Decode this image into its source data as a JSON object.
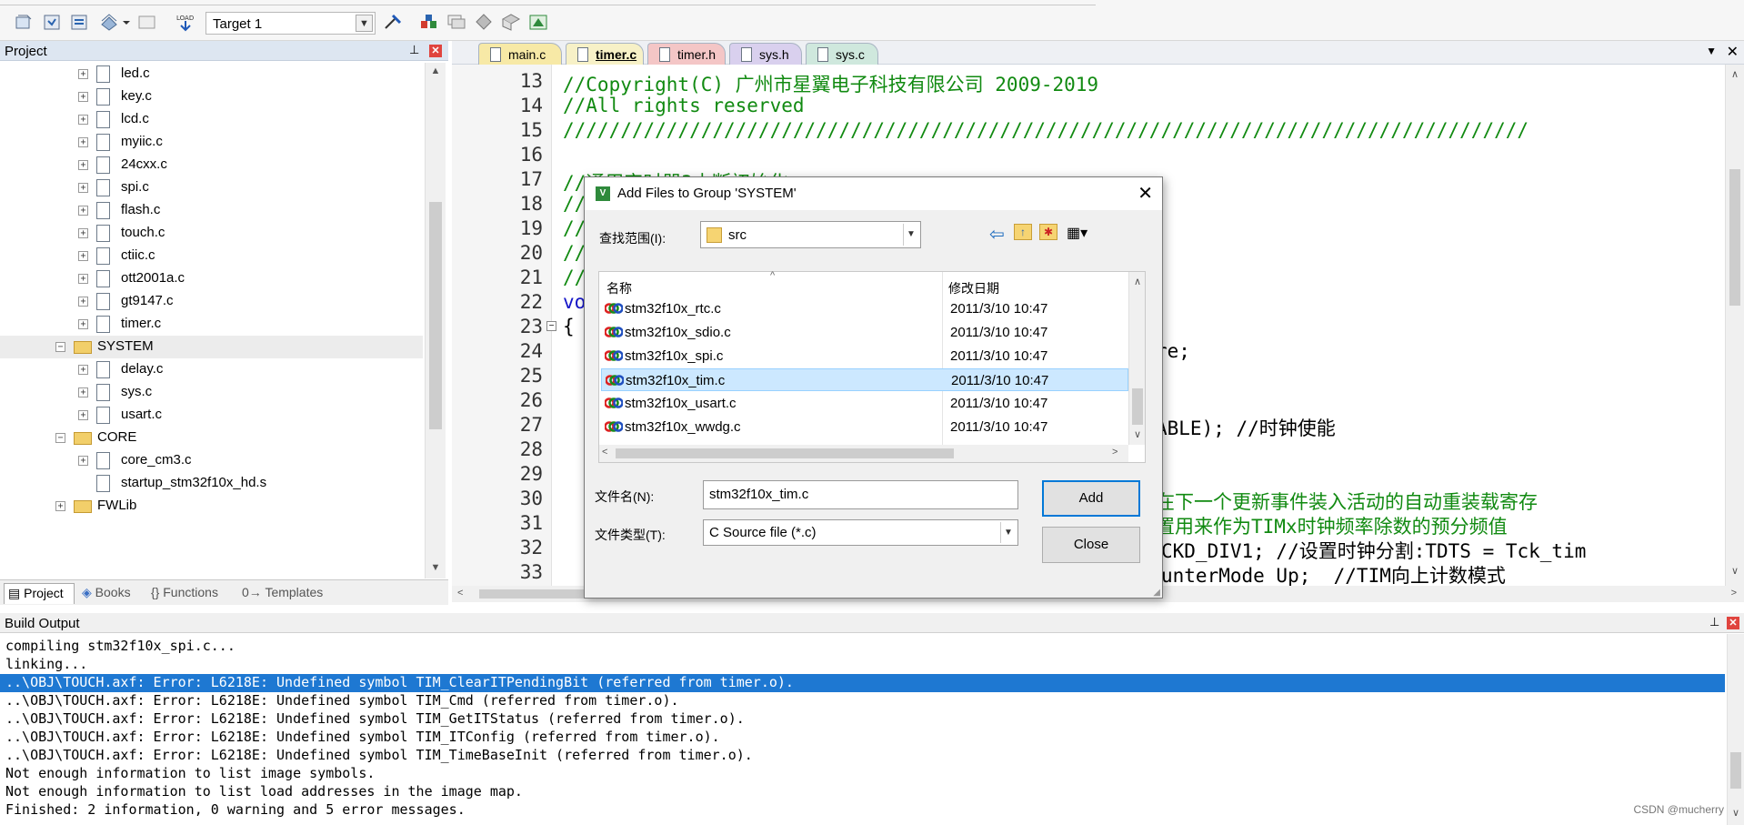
{
  "toolbar": {
    "target_value": "Target 1"
  },
  "project_panel": {
    "title": "Project",
    "tree": [
      {
        "label": "led.c",
        "kind": "file"
      },
      {
        "label": "key.c",
        "kind": "file"
      },
      {
        "label": "lcd.c",
        "kind": "file"
      },
      {
        "label": "myiic.c",
        "kind": "file"
      },
      {
        "label": "24cxx.c",
        "kind": "file"
      },
      {
        "label": "spi.c",
        "kind": "file"
      },
      {
        "label": "flash.c",
        "kind": "file"
      },
      {
        "label": "touch.c",
        "kind": "file"
      },
      {
        "label": "ctiic.c",
        "kind": "file"
      },
      {
        "label": "ott2001a.c",
        "kind": "file"
      },
      {
        "label": "gt9147.c",
        "kind": "file"
      },
      {
        "label": "timer.c",
        "kind": "file"
      },
      {
        "label": "SYSTEM",
        "kind": "group",
        "expanded": true
      },
      {
        "label": "delay.c",
        "kind": "file"
      },
      {
        "label": "sys.c",
        "kind": "file"
      },
      {
        "label": "usart.c",
        "kind": "file"
      },
      {
        "label": "CORE",
        "kind": "group",
        "expanded": true
      },
      {
        "label": "core_cm3.c",
        "kind": "file"
      },
      {
        "label": "startup_stm32f10x_hd.s",
        "kind": "file"
      },
      {
        "label": "FWLib",
        "kind": "group",
        "expanded": false
      }
    ],
    "tabs": [
      "Project",
      "Books",
      "Functions",
      "Templates"
    ]
  },
  "editor": {
    "tabs": [
      {
        "label": "main.c",
        "color": "#f7e9a6"
      },
      {
        "label": "timer.c",
        "color": "#f7f1c7"
      },
      {
        "label": "timer.h",
        "color": "#f4c6c6"
      },
      {
        "label": "sys.h",
        "color": "#d9d0ee"
      },
      {
        "label": "sys.c",
        "color": "#cfe8dd"
      }
    ],
    "lines": [
      {
        "n": "13",
        "text": "//Copyright(C) 广州市星翼电子科技有限公司 2009-2019"
      },
      {
        "n": "14",
        "text": "//All rights reserved"
      },
      {
        "n": "15",
        "text": "////////////////////////////////////////////////////////////////////////////////////"
      },
      {
        "n": "16",
        "text": ""
      },
      {
        "n": "17",
        "text": "//通用定时器3中断初始化"
      },
      {
        "n": "18",
        "text": "//"
      },
      {
        "n": "19",
        "text": "//"
      },
      {
        "n": "20",
        "text": "//"
      },
      {
        "n": "21",
        "text": "//"
      },
      {
        "n": "22",
        "text": "vo"
      },
      {
        "n": "23",
        "text": "{"
      },
      {
        "n": "24",
        "text": "re;"
      },
      {
        "n": "25",
        "text": ""
      },
      {
        "n": "26",
        "text": ""
      },
      {
        "n": "27",
        "text": "ABLE); //时钟使能"
      },
      {
        "n": "28",
        "text": ""
      },
      {
        "n": "29",
        "text": ""
      },
      {
        "n": "30",
        "text": "在下一个更新事件装入活动的自动重装载寄存"
      },
      {
        "n": "31",
        "text": "置用来作为TIMx时钟频率除数的预分频值"
      },
      {
        "n": "32",
        "text": "CKD_DIV1; //设置时钟分割:TDTS = Tck_tim"
      },
      {
        "n": "33",
        "text": "unterMode_Up;  //TIM向上计数模式"
      }
    ]
  },
  "build_output": {
    "title": "Build Output",
    "lines": [
      "compiling stm32f10x_spi.c...",
      "linking...",
      "..\\OBJ\\TOUCH.axf: Error: L6218E: Undefined symbol TIM_ClearITPendingBit (referred from timer.o).",
      "..\\OBJ\\TOUCH.axf: Error: L6218E: Undefined symbol TIM_Cmd (referred from timer.o).",
      "..\\OBJ\\TOUCH.axf: Error: L6218E: Undefined symbol TIM_GetITStatus (referred from timer.o).",
      "..\\OBJ\\TOUCH.axf: Error: L6218E: Undefined symbol TIM_ITConfig (referred from timer.o).",
      "..\\OBJ\\TOUCH.axf: Error: L6218E: Undefined symbol TIM_TimeBaseInit (referred from timer.o).",
      "Not enough information to list image symbols.",
      "Not enough information to list load addresses in the image map.",
      "Finished: 2 information, 0 warning and 5 error messages."
    ],
    "selected_index": 2,
    "selection_color": "#1e78d2"
  },
  "watermark": "CSDN @mucherry",
  "dialog": {
    "title": "Add Files to Group 'SYSTEM'",
    "lookin_label": "查找范围(I):",
    "lookin_value": "src",
    "col_name": "名称",
    "col_date": "修改日期",
    "files": [
      {
        "name": "stm32f10x_rtc.c",
        "date": "2011/3/10 10:47"
      },
      {
        "name": "stm32f10x_sdio.c",
        "date": "2011/3/10 10:47"
      },
      {
        "name": "stm32f10x_spi.c",
        "date": "2011/3/10 10:47"
      },
      {
        "name": "stm32f10x_tim.c",
        "date": "2011/3/10 10:47",
        "selected": true
      },
      {
        "name": "stm32f10x_usart.c",
        "date": "2011/3/10 10:47"
      },
      {
        "name": "stm32f10x_wwdg.c",
        "date": "2011/3/10 10:47"
      }
    ],
    "filename_label": "文件名(N):",
    "filename_value": "stm32f10x_tim.c",
    "filetype_label": "文件类型(T):",
    "filetype_value": "C Source file (*.c)",
    "add_label": "Add",
    "close_label": "Close"
  }
}
